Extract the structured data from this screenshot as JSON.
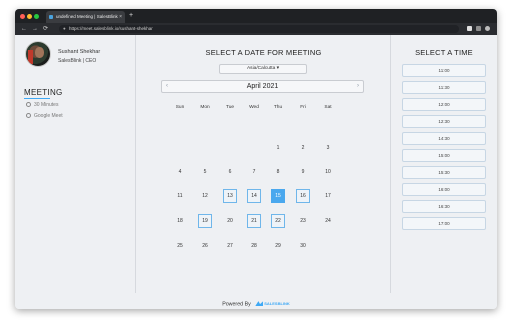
{
  "browser": {
    "tab_title": "undefined Meeting | SalesBlink",
    "tab_close": "×",
    "new_tab": "+",
    "back": "←",
    "forward": "→",
    "reload": "⟳",
    "url": "https://meet.salesblink.io/sushant-shekhar"
  },
  "host": {
    "name": "Sushant Shekhar",
    "title": "SalesBlink | CEO"
  },
  "event": {
    "title": "MEETING",
    "duration": "30 Minutes",
    "location": "Google Meet"
  },
  "calendar": {
    "heading": "SELECT A DATE FOR MEETING",
    "timezone": "Asia/Calcutta",
    "timezone_caret": "▾",
    "month": "April 2021",
    "prev": "‹",
    "next": "›",
    "weekdays": [
      "Sun",
      "Mon",
      "Tue",
      "Wed",
      "Thu",
      "Fri",
      "Sat"
    ],
    "weeks": [
      [
        null,
        null,
        null,
        null,
        {
          "d": "1"
        },
        {
          "d": "2"
        },
        {
          "d": "3"
        }
      ],
      [
        {
          "d": "4"
        },
        {
          "d": "5"
        },
        {
          "d": "6"
        },
        {
          "d": "7"
        },
        {
          "d": "8"
        },
        {
          "d": "9"
        },
        {
          "d": "10"
        }
      ],
      [
        {
          "d": "11"
        },
        {
          "d": "12"
        },
        {
          "d": "13",
          "s": "avail"
        },
        {
          "d": "14",
          "s": "avail"
        },
        {
          "d": "15",
          "s": "selected"
        },
        {
          "d": "16",
          "s": "avail"
        },
        {
          "d": "17"
        }
      ],
      [
        {
          "d": "18"
        },
        {
          "d": "19",
          "s": "avail"
        },
        {
          "d": "20"
        },
        {
          "d": "21",
          "s": "avail"
        },
        {
          "d": "22",
          "s": "avail"
        },
        {
          "d": "23"
        },
        {
          "d": "24"
        }
      ],
      [
        {
          "d": "25"
        },
        {
          "d": "26"
        },
        {
          "d": "27"
        },
        {
          "d": "28"
        },
        {
          "d": "29"
        },
        {
          "d": "30"
        },
        null
      ]
    ],
    "accent": "#4aa8ee"
  },
  "times": {
    "heading": "SELECT A TIME",
    "slots": [
      "11:00",
      "11:30",
      "12:00",
      "12:30",
      "14:30",
      "15:00",
      "15:30",
      "16:00",
      "16:30",
      "17:00"
    ]
  },
  "footer": {
    "powered_by": "Powered By",
    "brand": "SALESBLINK"
  }
}
